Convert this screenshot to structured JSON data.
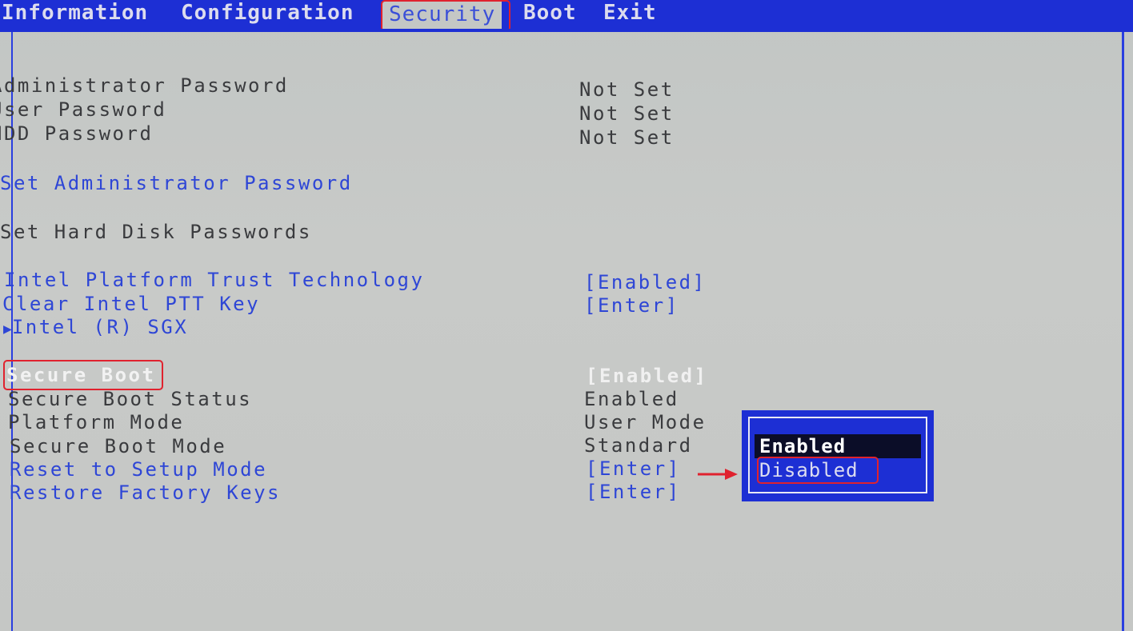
{
  "menu": {
    "tabs": [
      {
        "label": "Information"
      },
      {
        "label": "Configuration"
      },
      {
        "label": "Security",
        "active": true
      },
      {
        "label": "Boot"
      },
      {
        "label": "Exit"
      }
    ]
  },
  "security": {
    "admin_password": {
      "label": "Administrator Password",
      "value": "Not Set"
    },
    "user_password": {
      "label": "User Password",
      "value": "Not Set"
    },
    "hdd_password": {
      "label": "HDD Password",
      "value": "Not Set"
    },
    "set_admin_password": {
      "label": "Set Administrator Password"
    },
    "set_hdd_passwords": {
      "label": "Set Hard Disk Passwords"
    },
    "intel_ptt": {
      "label": "Intel Platform Trust Technology",
      "value": "[Enabled]"
    },
    "clear_ptt": {
      "label": "Clear Intel PTT Key",
      "value": "[Enter]"
    },
    "intel_sgx": {
      "label": "Intel (R) SGX",
      "submenu_marker": "▶"
    },
    "secure_boot": {
      "label": "Secure Boot",
      "value": "[Enabled]"
    },
    "secure_boot_status": {
      "label": "Secure Boot Status",
      "value": "Enabled"
    },
    "platform_mode": {
      "label": "Platform Mode",
      "value": "User Mode"
    },
    "secure_boot_mode": {
      "label": "Secure Boot Mode",
      "value": "Standard"
    },
    "reset_setup_mode": {
      "label": "Reset to Setup Mode",
      "value": "[Enter]"
    },
    "restore_factory_keys": {
      "label": "Restore Factory Keys",
      "value": "[Enter]"
    }
  },
  "popup": {
    "options": [
      {
        "label": "Enabled",
        "selected": true
      },
      {
        "label": "Disabled",
        "selected": false
      }
    ]
  },
  "colors": {
    "bios_blue": "#1d2fd4",
    "link_blue": "#2e46d6",
    "background_gray": "#c4c7c5",
    "annotation_red": "#e0222e"
  },
  "icons": {
    "submenu": "triangle-right-icon",
    "annotation": "red-arrow-right-icon"
  }
}
